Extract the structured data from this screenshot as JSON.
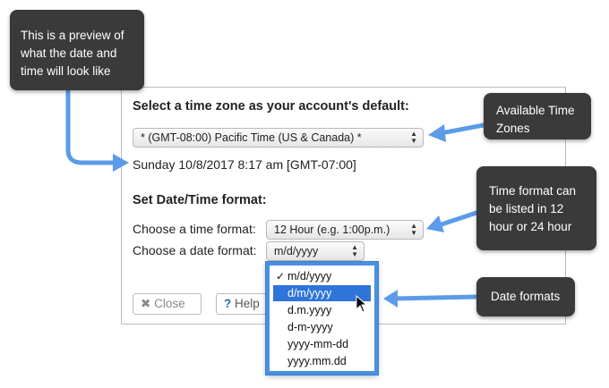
{
  "dialog": {
    "timezone_heading": "Select a time zone as your account's default:",
    "timezone_value": "* (GMT-08:00) Pacific Time (US & Canada) *",
    "preview_text": "Sunday 10/8/2017 8:17 am [GMT-07:00]",
    "format_heading": "Set Date/Time format:",
    "time_format_label": "Choose a time format:",
    "time_format_value": "12 Hour (e.g. 1:00p.m.)",
    "date_format_label": "Choose a date format:",
    "date_format_value": "m/d/yyyy",
    "close_button": "Close",
    "help_button": "Help"
  },
  "date_dropdown": {
    "options": [
      "m/d/yyyy",
      "d/m/yyyy",
      "d.m.yyyy",
      "d-m-yyyy",
      "yyyy-mm-dd",
      "yyyy.mm.dd"
    ],
    "checked_index": 0,
    "highlighted_index": 1,
    "check_mark": "✓"
  },
  "callouts": {
    "preview": "This is a preview of what the date and time will look like",
    "timezones": "Available Time Zones",
    "time_format": "Time format can be listed in 12 hour or 24 hour",
    "date_formats": "Date formats"
  },
  "colors": {
    "callout_bg": "#3a3a3a",
    "arrow": "#5b9be8",
    "highlight": "#2f74d8"
  }
}
